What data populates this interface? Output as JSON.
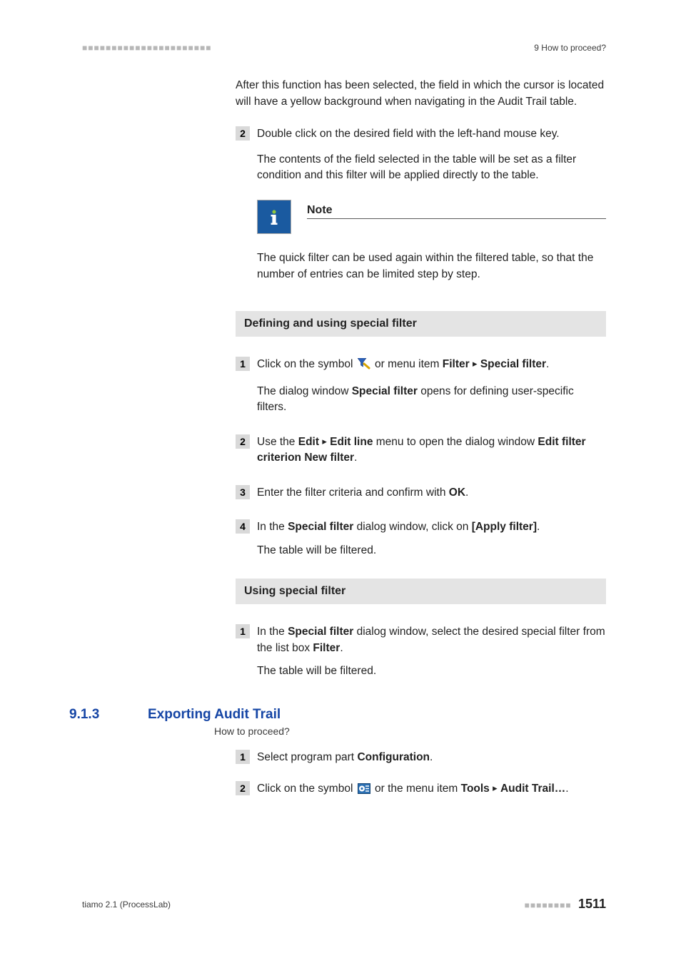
{
  "header": {
    "left_dots": "■■■■■■■■■■■■■■■■■■■■■■",
    "breadcrumb": "9 How to proceed?"
  },
  "intro": {
    "p1": "After this function has been selected, the field in which the cursor is located will have a yellow background when navigating in the Audit Trail table."
  },
  "stepA2": {
    "num": "2",
    "p1": "Double click on the desired field with the left-hand mouse key.",
    "p2": "The contents of the field selected in the table will be set as a filter condition and this filter will be applied directly to the table."
  },
  "note": {
    "label": "Note",
    "text": "The quick filter can be used again within the filtered table, so that the number of entries can be limited step by step."
  },
  "sectionB": {
    "title": "Defining and using special filter",
    "step1": {
      "num": "1",
      "p1a": "Click on the symbol ",
      "p1b": " or menu item ",
      "menu_filter": "Filter",
      "menu_special": "Special filter",
      "p1_end": ".",
      "p2a": "The dialog window ",
      "p2b": "Special filter",
      "p2c": " opens for defining user-specific filters."
    },
    "step2": {
      "num": "2",
      "p1a": "Use the ",
      "edit": "Edit",
      "edit_line": "Edit line",
      "p1b": " menu to open the dialog window ",
      "edit_filter_crit": "Edit filter criterion New filter",
      "p1_end": "."
    },
    "step3": {
      "num": "3",
      "p1a": "Enter the filter criteria and confirm with ",
      "ok": "OK",
      "p1_end": "."
    },
    "step4": {
      "num": "4",
      "p1a": "In the ",
      "special_filter": "Special filter",
      "p1b": " dialog window, click on ",
      "apply": "[Apply filter]",
      "p1_end": ".",
      "p2": "The table will be filtered."
    }
  },
  "sectionC": {
    "title": "Using special filter",
    "step1": {
      "num": "1",
      "p1a": "In the ",
      "sf": "Special filter",
      "p1b": " dialog window, select the desired special filter from the list box ",
      "filter": "Filter",
      "p1_end": ".",
      "p2": "The table will be filtered."
    }
  },
  "sectionD": {
    "number": "9.1.3",
    "title": "Exporting Audit Trail",
    "subtitle": "How to proceed?",
    "step1": {
      "num": "1",
      "p1a": "Select program part ",
      "config": "Configuration",
      "p1_end": "."
    },
    "step2": {
      "num": "2",
      "p1a": "Click on the symbol ",
      "p1b": " or the menu item ",
      "tools": "Tools",
      "audit": "Audit Trail…",
      "p1_end": "."
    }
  },
  "footer": {
    "product": "tiamo 2.1 (ProcessLab)",
    "dots": "■■■■■■■■",
    "page": "1511"
  }
}
